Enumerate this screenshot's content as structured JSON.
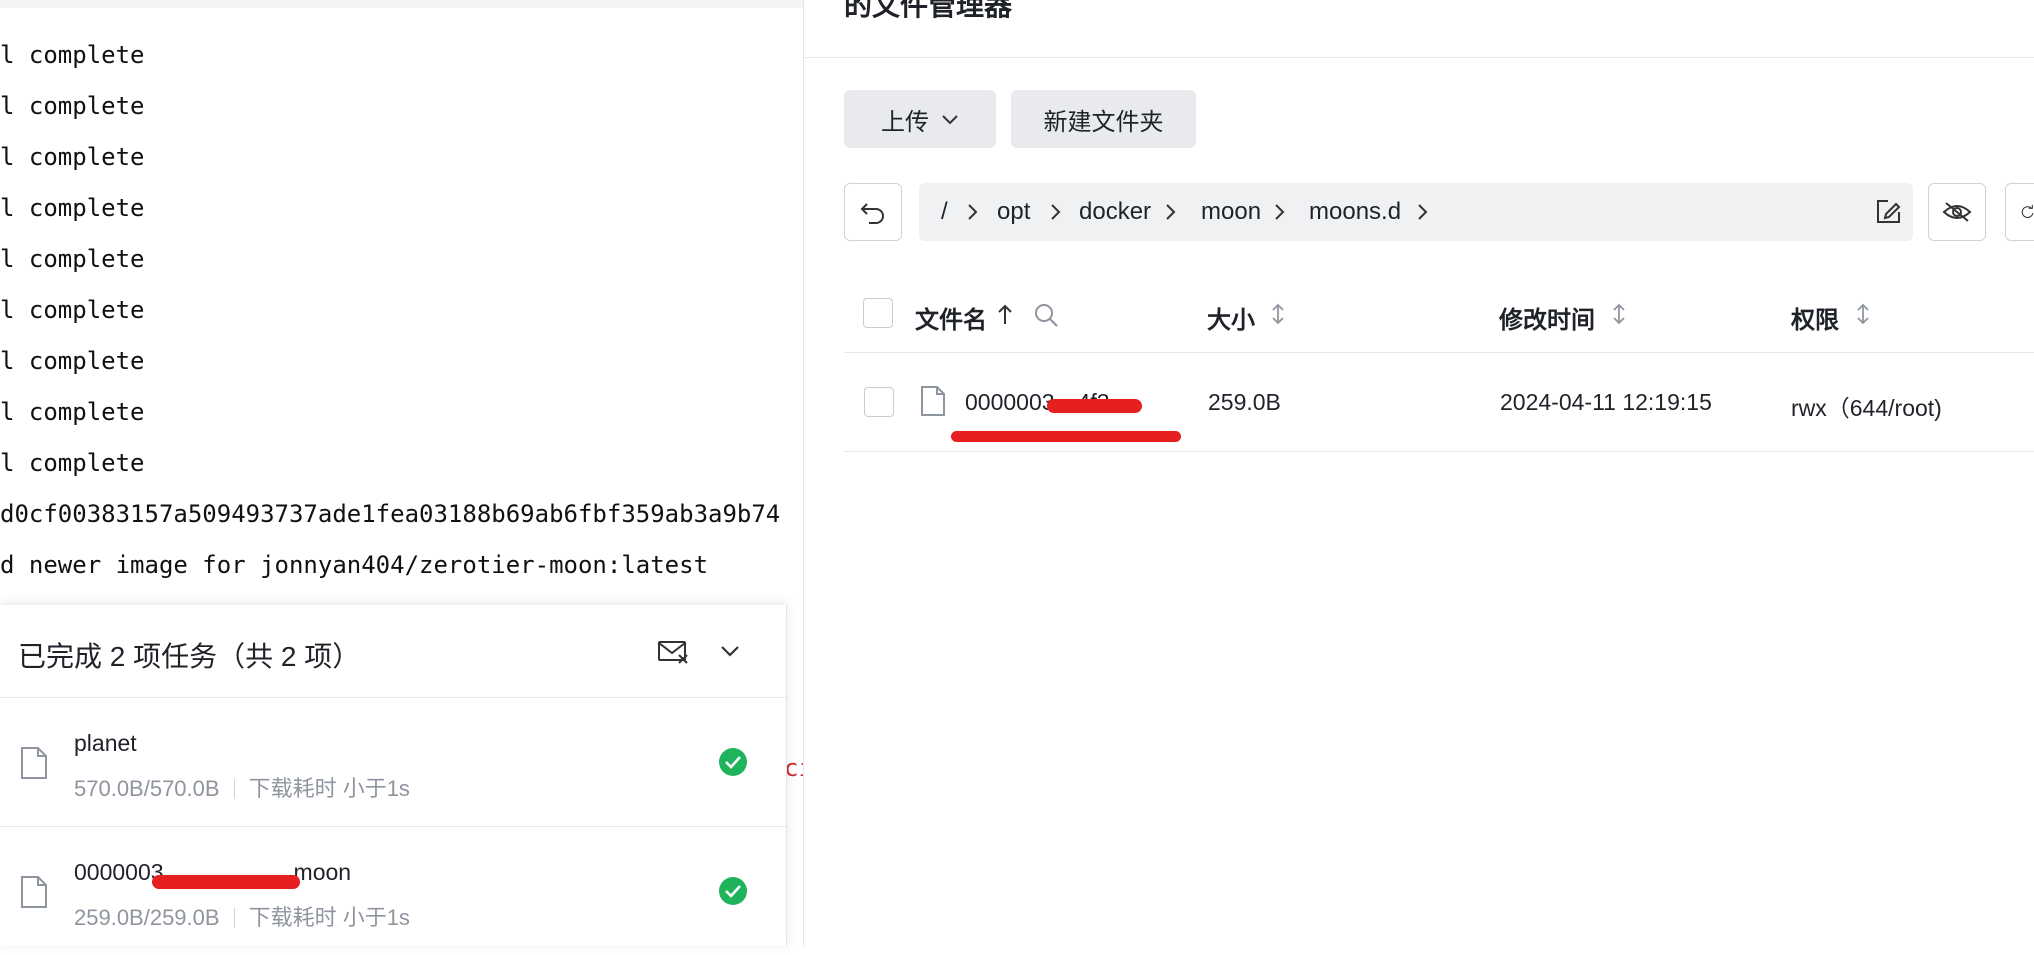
{
  "terminal": {
    "lines": [
      "l complete",
      "l complete",
      "l complete",
      "l complete",
      "l complete",
      "l complete",
      "l complete",
      "l complete",
      "l complete",
      "d0cf00383157a509493737ade1fea03188b69ab6fbf359ab3a9b74",
      "d newer image for jonnyan404/zerotier-moon:latest"
    ],
    "partial_red_text": "ci"
  },
  "task_panel": {
    "title": "已完成 2 项任务（共 2 项）",
    "tasks": [
      {
        "name": "planet",
        "size": "570.0B/570.0B",
        "duration": "下载耗时 小于1s"
      },
      {
        "name": "0000003",
        "name_suffix": "moon",
        "size": "259.0B/259.0B",
        "duration": "下载耗时 小于1s"
      }
    ]
  },
  "file_manager": {
    "title": "的文件管理器",
    "toolbar": {
      "upload_label": "上传",
      "new_folder_label": "新建文件夹"
    },
    "breadcrumb": [
      "/",
      "opt",
      "docker",
      "moon",
      "moons.d"
    ],
    "columns": {
      "name": "文件名",
      "size": "大小",
      "modified": "修改时间",
      "permission": "权限"
    },
    "rows": [
      {
        "name": "0000003…4f3…",
        "size": "259.0B",
        "modified": "2024-04-11 12:19:15",
        "permission": "rwx（644/root)"
      }
    ]
  },
  "colors": {
    "success": "#1fb35c",
    "redaction": "#e62020",
    "button_bg": "#e8eaed"
  }
}
